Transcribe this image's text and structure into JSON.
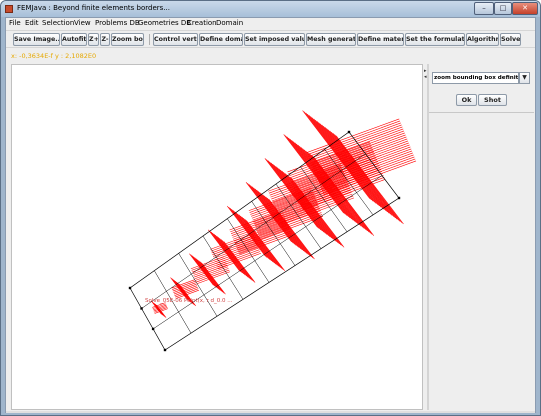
{
  "window": {
    "title": "FEMJava : Beyond finite elements borders...",
    "min_glyph": "–",
    "max_glyph": "□",
    "close_glyph": "✕"
  },
  "menubar": {
    "items": [
      "File",
      "Edit",
      "Selection",
      "View",
      "Problems DB",
      "Geometries DB",
      "Creation",
      "Domain"
    ]
  },
  "toolbar": {
    "buttons": [
      "Save Image...",
      "Autofit",
      "Z+",
      "Z-",
      "Zoom box",
      "Control vertex",
      "Define domain",
      "Set imposed values",
      "Mesh generator",
      "Define material",
      "Set the formulation",
      "Algorithm",
      "Solve"
    ]
  },
  "coords": "x: -0,3634E-f  y : 2,1082E0",
  "canvas": {
    "domain_label": "Solve_05E-06 Point(x, r d_0.0 ...",
    "colors": {
      "mesh": "#ff0000",
      "outline": "#000000",
      "label": "#d04040"
    }
  },
  "right_panel": {
    "selected_option": "zoom bounding box definition",
    "ok_label": "Ok",
    "shot_label": "Shot"
  }
}
